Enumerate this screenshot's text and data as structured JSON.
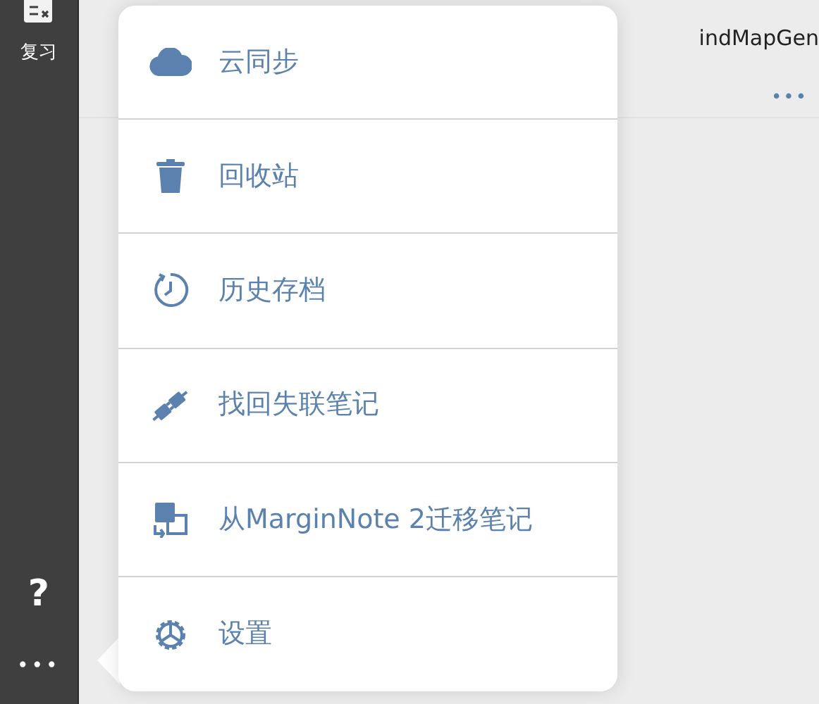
{
  "sidebar": {
    "top_item": {
      "label": "复习"
    },
    "help": "?",
    "more": "•••"
  },
  "document": {
    "title": "indMapGen",
    "more": "•••"
  },
  "menu": {
    "items": [
      {
        "kind": "cloud",
        "label": "云同步"
      },
      {
        "kind": "trash",
        "label": "回收站"
      },
      {
        "kind": "history",
        "label": "历史存档"
      },
      {
        "kind": "plug",
        "label": "找回失联笔记"
      },
      {
        "kind": "migrate",
        "label": "从MarginNote 2迁移笔记"
      },
      {
        "kind": "gear",
        "label": "设置"
      }
    ]
  }
}
